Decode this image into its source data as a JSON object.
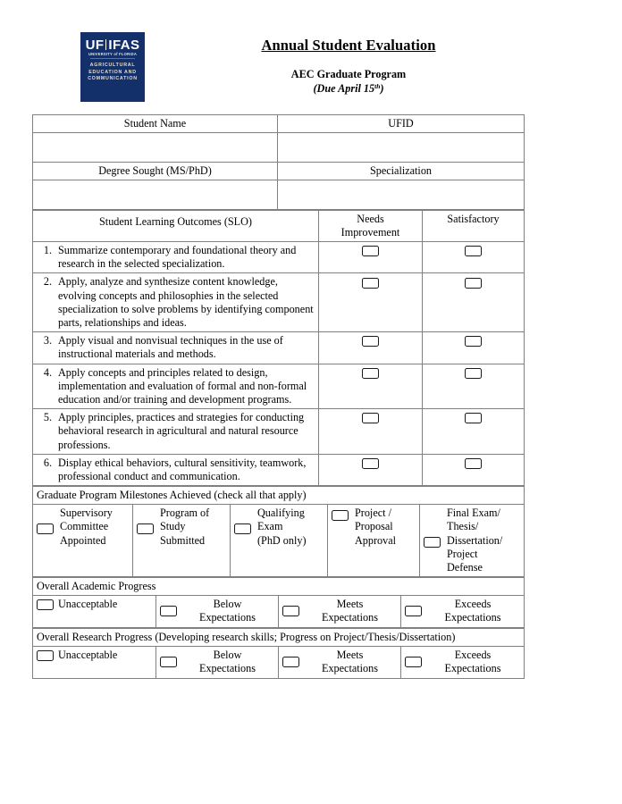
{
  "header": {
    "logo": {
      "uf": "UF",
      "ifas": "IFAS",
      "university": "UNIVERSITY of FLORIDA",
      "dept_line1": "AGRICULTURAL",
      "dept_line2": "EDUCATION AND",
      "dept_line3": "COMMUNICATION",
      "brand_color": "#13306B",
      "accent_color": "#C8531B"
    },
    "title": "Annual Student Evaluation",
    "subtitle": "AEC Graduate Program",
    "due_prefix": "(Due April 15",
    "due_sup": "th",
    "due_suffix": ")"
  },
  "student_table": {
    "name_label": "Student Name",
    "ufid_label": "UFID",
    "name_value": "",
    "ufid_value": "",
    "degree_label": "Degree Sought (MS/PhD)",
    "specialization_label": "Specialization",
    "degree_value": "",
    "specialization_value": ""
  },
  "slo_table": {
    "header_outcomes": "Student Learning Outcomes (SLO)",
    "header_needs_l1": "Needs",
    "header_needs_l2": "Improvement",
    "header_satisfactory": "Satisfactory",
    "rows": [
      {
        "num": "1.",
        "text": "Summarize contemporary and foundational theory and research in the selected specialization."
      },
      {
        "num": "2.",
        "text": "Apply, analyze and synthesize content knowledge, evolving concepts and philosophies in the selected specialization to solve problems by identifying component parts, relationships and ideas."
      },
      {
        "num": "3.",
        "text": "Apply visual and nonvisual techniques in the use of instructional materials and methods."
      },
      {
        "num": "4.",
        "text": "Apply concepts and principles related to design, implementation and evaluation of formal and non-formal education and/or training and development programs."
      },
      {
        "num": "5.",
        "text": "Apply principles, practices and strategies for conducting behavioral research in agricultural and natural resource professions."
      },
      {
        "num": "6.",
        "text": "Display ethical behaviors, cultural sensitivity, teamwork, professional conduct and communication."
      }
    ]
  },
  "milestones": {
    "header": "Graduate Program Milestones Achieved (check all that apply)",
    "items": [
      {
        "lines": [
          "Supervisory",
          "Committee",
          "Appointed"
        ],
        "box_line": 2
      },
      {
        "lines": [
          "Program of",
          "Study",
          "Submitted"
        ],
        "box_line": 2
      },
      {
        "lines": [
          "Qualifying",
          "Exam",
          "(PhD only)"
        ],
        "box_line": 2
      },
      {
        "lines": [
          "Project /",
          "Proposal",
          "Approval"
        ],
        "box_line": 1
      },
      {
        "lines": [
          "Final Exam/",
          "Thesis/",
          "Dissertation/",
          "Project",
          "Defense"
        ],
        "box_line": 3
      }
    ]
  },
  "academic_progress": {
    "header": "Overall Academic Progress",
    "options": [
      {
        "label": "Unacceptable",
        "line2": ""
      },
      {
        "label": "Below",
        "line2": "Expectations"
      },
      {
        "label": "Meets",
        "line2": "Expectations"
      },
      {
        "label": "Exceeds",
        "line2": "Expectations"
      }
    ]
  },
  "research_progress": {
    "header": "Overall Research Progress (Developing research skills; Progress on Project/Thesis/Dissertation)",
    "options": [
      {
        "label": "Unacceptable",
        "line2": ""
      },
      {
        "label": "Below",
        "line2": "Expectations"
      },
      {
        "label": "Meets",
        "line2": "Expectations"
      },
      {
        "label": "Exceeds",
        "line2": "Expectations"
      }
    ]
  }
}
